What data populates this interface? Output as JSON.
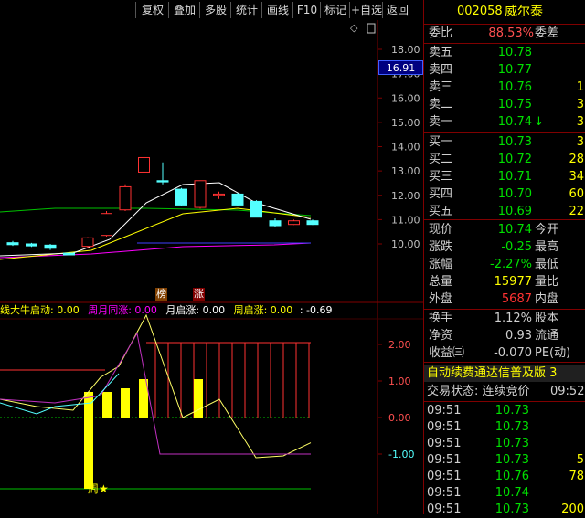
{
  "toolbar": {
    "buttons": [
      "复权",
      "叠加",
      "多股",
      "统计",
      "画线",
      "F10",
      "标记",
      "+自选",
      "返回"
    ]
  },
  "chart": {
    "price_axis": [
      "18.00",
      "17.00",
      "16.00",
      "15.00",
      "14.00",
      "13.00",
      "12.00",
      "11.00",
      "10.00"
    ],
    "current_price_tag": "16.91",
    "markers": [
      "榜",
      "涨"
    ],
    "indicator_header": {
      "title": "线大牛启动: 0.00",
      "t2": "周月同涨: 0.00",
      "t3": "月启涨: 0.00",
      "t4": "周启涨: 0.00",
      "t5": ": -0.69"
    },
    "indicator_axis": [
      "2.00",
      "1.00",
      "0.00",
      "-1.00"
    ],
    "star_label": "周★",
    "colors": {
      "up": "#ff3232",
      "down": "#54ffff",
      "yellow": "#ffff00",
      "magenta": "#ff00ff",
      "green": "#00c000"
    }
  },
  "chart_data": {
    "type": "candlestick",
    "candles": [
      {
        "o": 10.05,
        "h": 10.12,
        "l": 9.92,
        "c": 9.97
      },
      {
        "o": 10.0,
        "h": 10.04,
        "l": 9.88,
        "c": 9.92
      },
      {
        "o": 9.95,
        "h": 10.0,
        "l": 9.75,
        "c": 9.82
      },
      {
        "o": 9.62,
        "h": 9.7,
        "l": 9.5,
        "c": 9.55
      },
      {
        "o": 9.9,
        "h": 10.28,
        "l": 9.85,
        "c": 10.25
      },
      {
        "o": 10.35,
        "h": 11.35,
        "l": 10.3,
        "c": 11.25
      },
      {
        "o": 11.4,
        "h": 12.45,
        "l": 11.35,
        "c": 12.35
      },
      {
        "o": 12.95,
        "h": 13.55,
        "l": 12.9,
        "c": 13.55
      },
      {
        "o": 12.6,
        "h": 13.35,
        "l": 12.45,
        "c": 12.55
      },
      {
        "o": 12.25,
        "h": 12.3,
        "l": 11.55,
        "c": 11.6
      },
      {
        "o": 11.5,
        "h": 12.6,
        "l": 11.45,
        "c": 12.6
      },
      {
        "o": 12.0,
        "h": 12.15,
        "l": 11.85,
        "c": 12.05
      },
      {
        "o": 12.05,
        "h": 12.1,
        "l": 11.55,
        "c": 11.6
      },
      {
        "o": 11.75,
        "h": 11.8,
        "l": 11.1,
        "c": 11.1
      },
      {
        "o": 10.95,
        "h": 11.05,
        "l": 10.7,
        "c": 10.75
      },
      {
        "o": 10.8,
        "h": 11.0,
        "l": 10.78,
        "c": 10.95
      },
      {
        "o": 10.95,
        "h": 11.0,
        "l": 10.78,
        "c": 10.8
      }
    ],
    "ylim": [
      9.0,
      18.0
    ]
  },
  "panel": {
    "code": "002058",
    "name": "威尔泰",
    "weibi": {
      "label": "委比",
      "value": "88.53%",
      "label2": "委差"
    },
    "sells": [
      {
        "label": "卖五",
        "price": "10.78",
        "vol": ""
      },
      {
        "label": "卖四",
        "price": "10.77",
        "vol": ""
      },
      {
        "label": "卖三",
        "price": "10.76",
        "vol": "1"
      },
      {
        "label": "卖二",
        "price": "10.75",
        "vol": "3"
      },
      {
        "label": "卖一",
        "price": "10.74",
        "vol": "3",
        "arrow": "↓"
      }
    ],
    "buys": [
      {
        "label": "买一",
        "price": "10.73",
        "vol": "3"
      },
      {
        "label": "买二",
        "price": "10.72",
        "vol": "28"
      },
      {
        "label": "买三",
        "price": "10.71",
        "vol": "34"
      },
      {
        "label": "买四",
        "price": "10.70",
        "vol": "60"
      },
      {
        "label": "买五",
        "price": "10.69",
        "vol": "22"
      }
    ],
    "stats": [
      {
        "l1": "现价",
        "v1": "10.74",
        "l2": "今开",
        "c": "#00e000"
      },
      {
        "l1": "涨跌",
        "v1": "-0.25",
        "l2": "最高",
        "c": "#00e000"
      },
      {
        "l1": "涨幅",
        "v1": "-2.27%",
        "l2": "最低",
        "c": "#00e000"
      },
      {
        "l1": "总量",
        "v1": "15977",
        "l2": "量比",
        "c": "#ffff00"
      },
      {
        "l1": "外盘",
        "v1": "5687",
        "l2": "内盘",
        "c": "#ff3232"
      }
    ],
    "stats2": [
      {
        "l1": "换手",
        "v1": "1.12%",
        "l2": "股本",
        "c": "#d0d0d0"
      },
      {
        "l1": "净资",
        "v1": "0.93",
        "l2": "流通",
        "c": "#d0d0d0"
      },
      {
        "l1": "收益㈢",
        "v1": "-0.070",
        "l2": "PE(动)",
        "c": "#d0d0d0"
      }
    ],
    "banner": "自动续费通达信普及版  3",
    "trade_status": "交易状态: 连续竞价",
    "trade_time": "09:52",
    "ticks": [
      {
        "t": "09:51",
        "p": "10.73",
        "v": ""
      },
      {
        "t": "09:51",
        "p": "10.73",
        "v": ""
      },
      {
        "t": "09:51",
        "p": "10.73",
        "v": ""
      },
      {
        "t": "09:51",
        "p": "10.73",
        "v": "5"
      },
      {
        "t": "09:51",
        "p": "10.76",
        "v": "78"
      },
      {
        "t": "09:51",
        "p": "10.74",
        "v": ""
      },
      {
        "t": "09:51",
        "p": "10.73",
        "v": "200"
      }
    ]
  }
}
